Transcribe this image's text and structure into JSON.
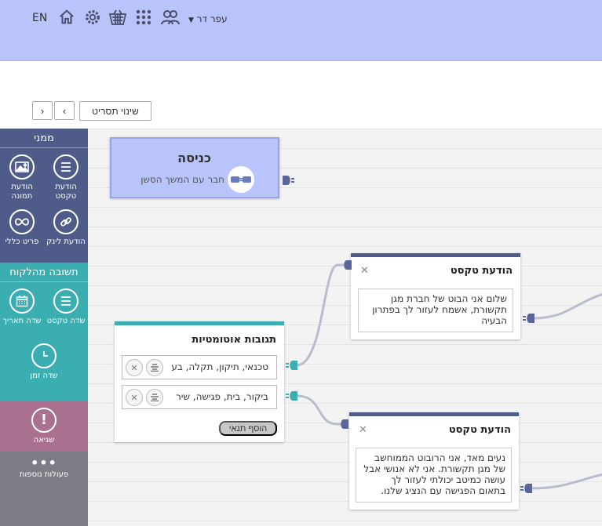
{
  "topbar": {
    "lang": "EN",
    "user_name": "עפר דר",
    "icons": [
      "home-icon",
      "gear-icon",
      "basket-icon",
      "apps-grid-icon",
      "users-icon"
    ]
  },
  "toolbar": {
    "rename_label": "שינוי תסריט",
    "prev_label": "‹",
    "next_label": "›"
  },
  "panel": {
    "from_me": {
      "title": "ממני",
      "items": [
        {
          "label": "הודעת טקסט",
          "icon": "list-icon"
        },
        {
          "label": "הודעת תמונה",
          "icon": "image-icon"
        },
        {
          "label": "הודעת לינק",
          "icon": "link-icon"
        },
        {
          "label": "פריט כללי",
          "icon": "infinity-icon"
        }
      ]
    },
    "from_client": {
      "title": "תשובה מהלקוח",
      "items": [
        {
          "label": "שדה טקסט",
          "icon": "list-icon"
        },
        {
          "label": "שדה תאריך",
          "icon": "calendar-icon"
        },
        {
          "label": "שדה זמן",
          "icon": "clock-icon"
        }
      ]
    },
    "error": {
      "label": "שגיאה",
      "icon": "exclamation-icon"
    },
    "more": {
      "label": "פעולות נוספות",
      "icon": "dots-icon"
    }
  },
  "canvas": {
    "entry": {
      "title": "כניסה",
      "subtitle": "חבר עם המשך הסשן"
    },
    "msg1": {
      "title": "הודעת טקסט",
      "text": "שלום אני הבוט של חברת מגן תקשורת, אשמח לעזור לך בפתרון הבעיה"
    },
    "msg2": {
      "title": "הודעת טקסט",
      "text": "נעים מאד, אני הרובוט הממוחשב של מגן תקשורת. אני לא אנושי אבל עושה כמיטב יכולתי לעזור לך בתאום הפגישה עם הנציג שלנו."
    },
    "auto": {
      "title": "תגובות אוטומטיות",
      "conditions": [
        "טכנאי, תיקון, תקלה, בע",
        "ביקור, בית, פגישה, שיר"
      ],
      "add_label": "הוסף תנאי"
    }
  },
  "colors": {
    "topbar": "#b9c4fb",
    "panel_me": "#4f5b88",
    "panel_client": "#3aaeb0",
    "panel_error": "#a9708f",
    "panel_more": "#7d7d85",
    "connector": "#b8bccc"
  }
}
